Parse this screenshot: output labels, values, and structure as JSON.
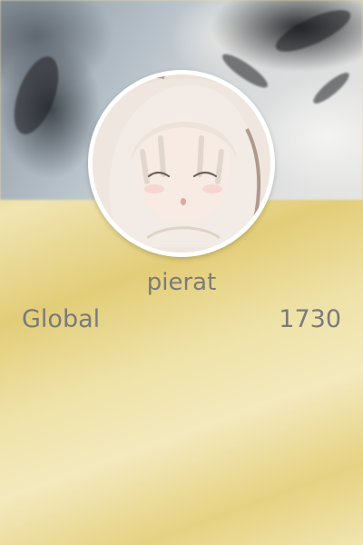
{
  "profile": {
    "username": "pierat",
    "avatar_icon": "anime-girl-avatar"
  },
  "rank": {
    "label": "Global",
    "value": "1730"
  },
  "colors": {
    "card_background": "#ebdc98",
    "text": "#7a7a7a",
    "avatar_ring": "#ffffff"
  }
}
